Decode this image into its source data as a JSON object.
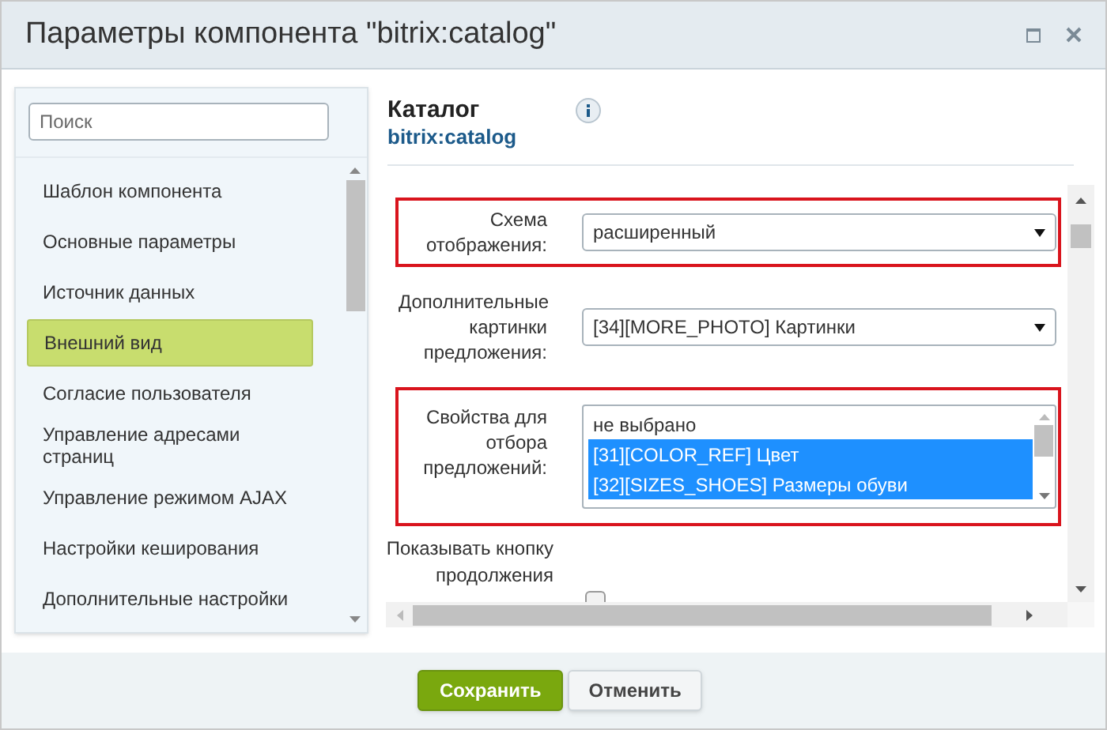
{
  "window": {
    "title": "Параметры компонента \"bitrix:catalog\""
  },
  "sidebar": {
    "search": {
      "placeholder": "Поиск"
    },
    "items": [
      {
        "label": "Шаблон компонента",
        "selected": false
      },
      {
        "label": "Основные параметры",
        "selected": false
      },
      {
        "label": "Источник данных",
        "selected": false
      },
      {
        "label": "Внешний вид",
        "selected": true
      },
      {
        "label": "Согласие пользователя",
        "selected": false
      },
      {
        "label": "Управление адресами страниц",
        "selected": false
      },
      {
        "label": "Управление режимом AJAX",
        "selected": false
      },
      {
        "label": "Настройки кеширования",
        "selected": false
      },
      {
        "label": "Дополнительные настройки",
        "selected": false
      }
    ]
  },
  "header": {
    "title": "Каталог",
    "subtitle": "bitrix:catalog"
  },
  "fields": [
    {
      "kind": "select",
      "label": "Схема отображения:",
      "value": "расширенный",
      "highlighted": true
    },
    {
      "kind": "select",
      "label": "Дополнительные картинки предложения:",
      "value": "[34][MORE_PHOTO] Картинки",
      "highlighted": false
    },
    {
      "kind": "listbox",
      "label": "Свойства для отбора предложений:",
      "highlighted": true,
      "options": [
        {
          "label": "не выбрано",
          "selected": false
        },
        {
          "label": "[31][COLOR_REF] Цвет",
          "selected": true
        },
        {
          "label": "[32][SIZES_SHOES] Размеры обуви",
          "selected": true
        }
      ]
    },
    {
      "kind": "checkbox",
      "label": "Показывать кнопку продолжения",
      "checked": false,
      "highlighted": false
    }
  ],
  "buttons": [
    {
      "label": "Сохранить",
      "kind": "primary"
    },
    {
      "label": "Отменить",
      "kind": "secondary"
    }
  ]
}
